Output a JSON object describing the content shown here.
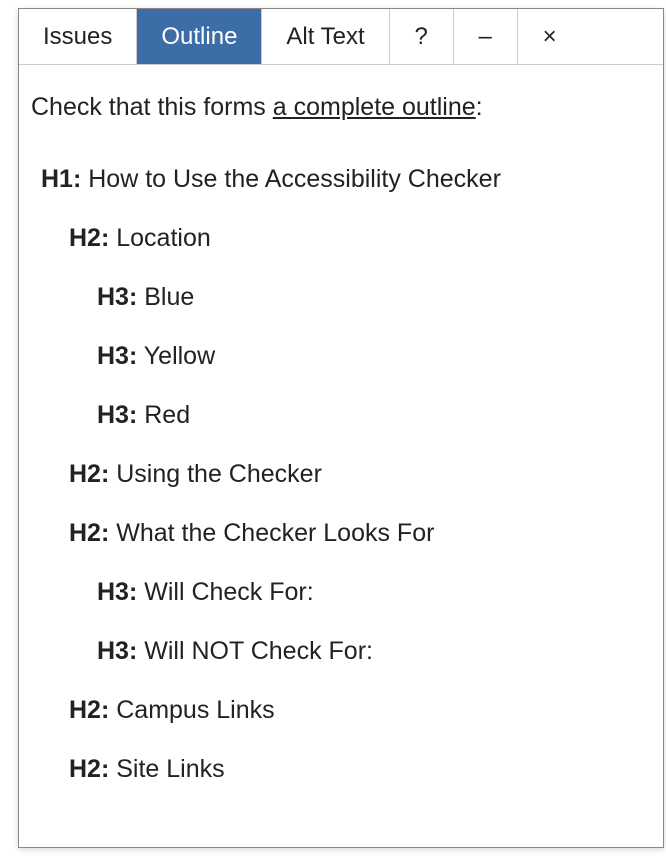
{
  "tabs": {
    "issues": "Issues",
    "outline": "Outline",
    "alttext": "Alt Text",
    "help": "?",
    "minimize": "–",
    "close": "×"
  },
  "intro": {
    "prefix": "Check that this forms ",
    "link": "a complete outline",
    "suffix": ":"
  },
  "outline": [
    {
      "level": 1,
      "label": "H1:",
      "text": "How to Use the Accessibility Checker"
    },
    {
      "level": 2,
      "label": "H2:",
      "text": "Location"
    },
    {
      "level": 3,
      "label": "H3:",
      "text": "Blue"
    },
    {
      "level": 3,
      "label": "H3:",
      "text": "Yellow"
    },
    {
      "level": 3,
      "label": "H3:",
      "text": "Red"
    },
    {
      "level": 2,
      "label": "H2:",
      "text": "Using the Checker"
    },
    {
      "level": 2,
      "label": "H2:",
      "text": "What the Checker Looks For"
    },
    {
      "level": 3,
      "label": "H3:",
      "text": "Will Check For:"
    },
    {
      "level": 3,
      "label": "H3:",
      "text": "Will NOT Check For:"
    },
    {
      "level": 2,
      "label": "H2:",
      "text": "Campus Links"
    },
    {
      "level": 2,
      "label": "H2:",
      "text": "Site Links"
    }
  ]
}
